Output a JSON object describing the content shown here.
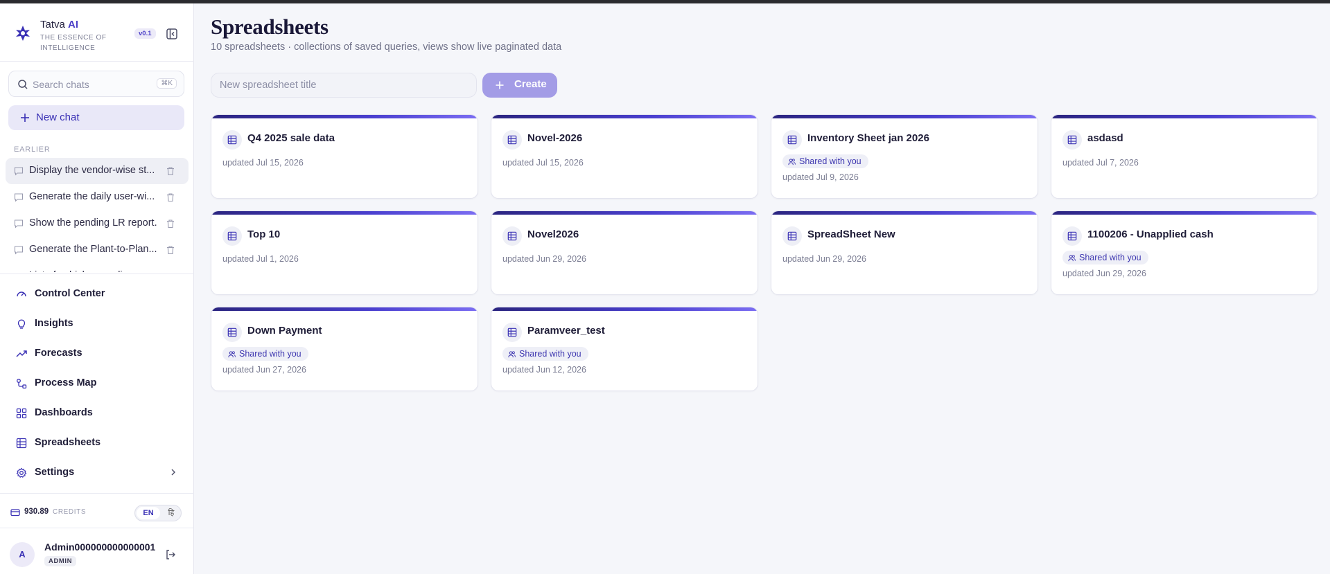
{
  "brand": {
    "name": "Tatva",
    "name_ai": "AI",
    "tagline": "THE ESSENCE OF INTELLIGENCE",
    "version": "v0.1"
  },
  "sidebar": {
    "search_placeholder": "Search chats",
    "search_shortcut": "⌘K",
    "new_chat_label": "New chat",
    "earlier_label": "EARLIER",
    "chats": [
      {
        "label": "Display the vendor-wise st..."
      },
      {
        "label": "Generate the daily user-wi..."
      },
      {
        "label": "Show the pending LR report."
      },
      {
        "label": "Generate the Plant-to-Plan..."
      },
      {
        "label": "List of vehicles pending ..."
      }
    ],
    "nav": [
      {
        "label": "Control Center",
        "icon": "gauge-icon"
      },
      {
        "label": "Insights",
        "icon": "lightbulb-icon"
      },
      {
        "label": "Forecasts",
        "icon": "trending-up-icon"
      },
      {
        "label": "Process Map",
        "icon": "process-map-icon"
      },
      {
        "label": "Dashboards",
        "icon": "dashboard-grid-icon"
      },
      {
        "label": "Spreadsheets",
        "icon": "table-icon"
      },
      {
        "label": "Settings",
        "icon": "gear-icon"
      }
    ],
    "credits_value": "930.89",
    "credits_label": "CREDITS",
    "lang_en": "EN",
    "lang_hi": "हि",
    "user_initial": "A",
    "user_name": "Admin000000000000001",
    "user_role": "ADMIN"
  },
  "main": {
    "title": "Spreadsheets",
    "subtitle": "10 spreadsheets · collections of saved queries, views show live paginated data",
    "new_placeholder": "New spreadsheet title",
    "create_label": "Create",
    "shared_label": "Shared with you",
    "cards": [
      {
        "title": "Q4 2025 sale data",
        "updated": "updated Jul 15, 2026",
        "shared": false
      },
      {
        "title": "Novel-2026",
        "updated": "updated Jul 15, 2026",
        "shared": false
      },
      {
        "title": "Inventory Sheet jan 2026",
        "updated": "updated Jul 9, 2026",
        "shared": true
      },
      {
        "title": "asdasd",
        "updated": "updated Jul 7, 2026",
        "shared": false
      },
      {
        "title": "Top 10",
        "updated": "updated Jul 1, 2026",
        "shared": false
      },
      {
        "title": "Novel2026",
        "updated": "updated Jun 29, 2026",
        "shared": false
      },
      {
        "title": "SpreadSheet New",
        "updated": "updated Jun 29, 2026",
        "shared": false
      },
      {
        "title": "1100206 - Unapplied cash",
        "updated": "updated Jun 29, 2026",
        "shared": true
      },
      {
        "title": "Down Payment",
        "updated": "updated Jun 27, 2026",
        "shared": true
      },
      {
        "title": "Paramveer_test",
        "updated": "updated Jun 12, 2026",
        "shared": true
      }
    ]
  },
  "colors": {
    "accent": "#4b3fc7",
    "create_button": "#a39ce6",
    "card_bar_start": "#2b2580",
    "card_bar_end": "#7b6df2"
  }
}
